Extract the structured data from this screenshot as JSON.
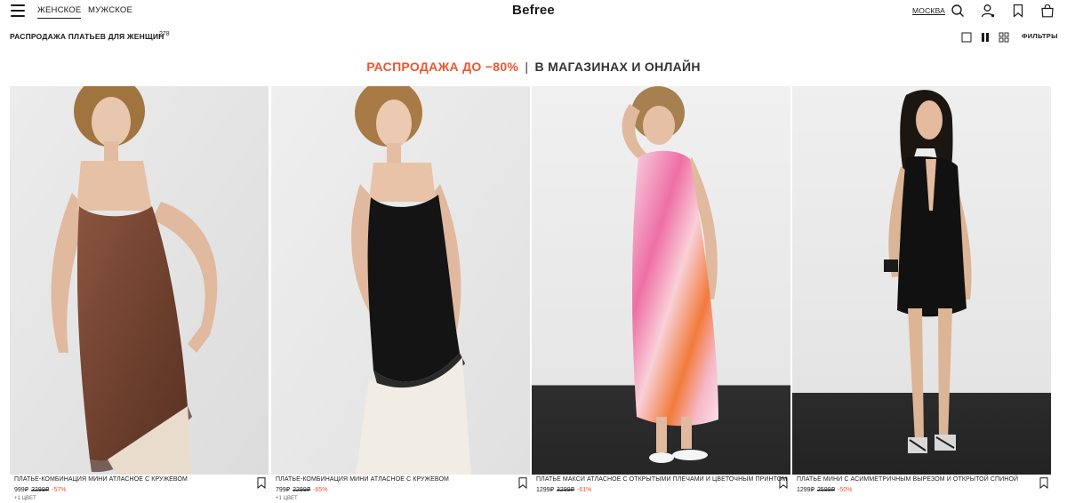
{
  "header": {
    "tabs": [
      {
        "label": "ЖЕНСКОЕ",
        "active": true
      },
      {
        "label": "МУЖСКОЕ",
        "active": false
      }
    ],
    "logo": "Befree",
    "city": "МОСКВА",
    "icons": [
      "menu-icon",
      "search-icon",
      "account-icon",
      "bookmark-icon",
      "bag-icon"
    ]
  },
  "subbar": {
    "title": "РАСПРОДАЖА ПЛАТЬЕВ ДЛЯ ЖЕНЩИН",
    "count": "278",
    "views": [
      "single-view-icon",
      "two-column-view-icon",
      "grid-view-icon"
    ],
    "filters": "ФИЛЬТРЫ"
  },
  "banner": {
    "accent": "РАСПРОДАЖА ДО −80%",
    "separator": "|",
    "rest": "В МАГАЗИНАХ И ОНЛАЙН",
    "accent_color": "#f0552e"
  },
  "products": [
    {
      "title": "ПЛАТЬЕ-КОМБИНАЦИЯ МИНИ АТЛАСНОЕ С КРУЖЕВОМ",
      "price": "999₽",
      "old_price": "2299₽",
      "discount": "-57%",
      "colors": "+1 ЦВЕТ",
      "dress_color": "#7a4a36"
    },
    {
      "title": "ПЛАТЬЕ-КОМБИНАЦИЯ МИНИ АТЛАСНОЕ С КРУЖЕВОМ",
      "price": "799₽",
      "old_price": "2299₽",
      "discount": "-65%",
      "colors": "+1 ЦВЕТ",
      "dress_color": "#151515"
    },
    {
      "title": "ПЛАТЬЕ МАКСИ АТЛАСНОЕ С ОТКРЫТЫМИ ПЛЕЧАМИ И ЦВЕТОЧНЫМ ПРИНТОМ",
      "price": "1299₽",
      "old_price": "3299₽",
      "discount": "-61%",
      "colors": "",
      "dress_color": "#f3a0c0"
    },
    {
      "title": "ПЛАТЬЕ МИНИ С АСИММЕТРИЧНЫМ ВЫРЕЗОМ И ОТКРЫТОЙ СПИНОЙ",
      "price": "1299₽",
      "old_price": "2599₽",
      "discount": "-50%",
      "colors": "",
      "dress_color": "#141414"
    }
  ]
}
